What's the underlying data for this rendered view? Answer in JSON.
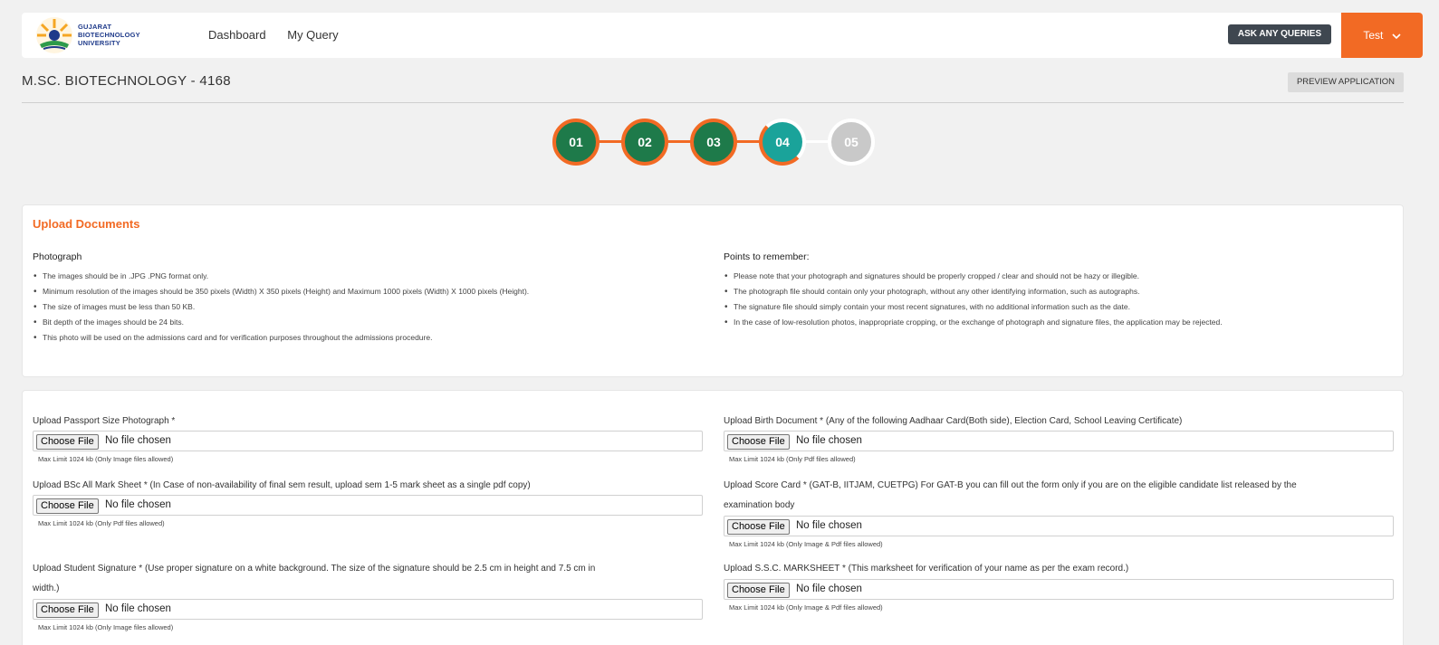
{
  "header": {
    "logo_lines": [
      "GUJARAT",
      "BIOTECHNOLOGY",
      "UNIVERSITY"
    ],
    "nav": [
      "Dashboard",
      "My Query"
    ],
    "ask_label": "ASK ANY QUERIES",
    "user_label": "Test",
    "user_chevron": "⌄"
  },
  "page": {
    "title": "M.SC. BIOTECHNOLOGY - 4168",
    "preview_label": "PREVIEW APPLICATION"
  },
  "steps": [
    "01",
    "02",
    "03",
    "04",
    "05"
  ],
  "colors": {
    "accent": "#f26a24",
    "done": "#1e7a4a",
    "active": "#1aa39a",
    "todo": "#c9c9c9"
  },
  "upload_info": {
    "title": "Upload Documents",
    "photograph_title": "Photograph",
    "photograph_points": [
      "The images should be in .JPG .PNG format only.",
      "Minimum resolution of the images should be 350 pixels (Width) X 350 pixels (Height) and Maximum 1000 pixels (Width) X 1000 pixels (Height).",
      "The size of images must be less than 50 KB.",
      "Bit depth of the images should be 24 bits.",
      "This photo will be used on the admissions card and for verification purposes throughout the admissions procedure."
    ],
    "remember_title": "Points to remember:",
    "remember_points": [
      "Please note that your photograph and signatures should be properly cropped / clear and should not be hazy or illegible.",
      "The photograph file should contain only your photograph, without any other identifying information, such as autographs.",
      "The signature file should simply contain your most recent signatures, with no additional information such as the date.",
      "In the case of low-resolution photos, inappropriate cropping, or the exchange of photograph and signature files, the application may be rejected."
    ]
  },
  "uploads": {
    "choose_label": "Choose File",
    "no_file_label": "No file chosen",
    "passport": {
      "label": "Upload Passport Size Photograph *",
      "limit": "Max Limit 1024 kb (Only Image files allowed)"
    },
    "marksheet": {
      "label": "Upload BSc All Mark Sheet * (In Case of non-availability of final sem result, upload sem 1-5 mark sheet as a single pdf copy)",
      "limit": "Max Limit 1024 kb (Only Pdf files allowed)"
    },
    "signature": {
      "label_line1": "Upload Student Signature * (Use proper signature on a white background. The size of the signature should be 2.5 cm in height and 7.5 cm in",
      "label_line2": "width.)",
      "limit": "Max Limit 1024 kb (Only Image files allowed)"
    },
    "birth": {
      "label": "Upload Birth Document * (Any of the following Aadhaar Card(Both side), Election Card, School Leaving Certificate)",
      "limit": "Max Limit 1024 kb (Only Pdf files allowed)"
    },
    "score": {
      "label_line1": "Upload Score Card * (GAT-B, IITJAM, CUETPG) For GAT-B you can fill out the form only if you are on the eligible candidate list released by the",
      "label_line2": "examination body",
      "limit": "Max Limit 1024 kb (Only Image & Pdf files allowed)"
    },
    "ssc": {
      "label": "Upload S.S.C. MARKSHEET * (This marksheet for verification of your name as per the exam record.)",
      "limit": "Max Limit 1024 kb (Only Image & Pdf files allowed)"
    }
  }
}
